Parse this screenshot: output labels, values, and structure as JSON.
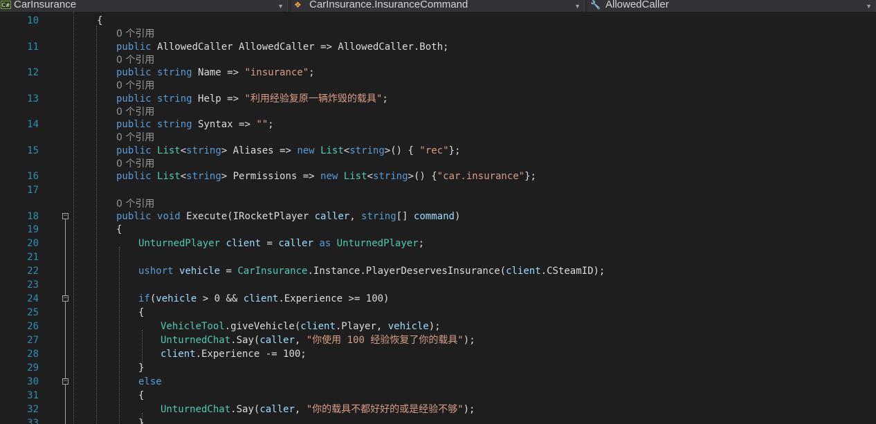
{
  "navbar": {
    "project_badge": "C#",
    "project": "CarInsurance",
    "type_member": "CarInsurance.InsuranceCommand",
    "member": "AllowedCaller"
  },
  "editor": {
    "lenses": {
      "l11": "0 个引用",
      "l12": "0 个引用",
      "l13": "0 个引用",
      "l14": "0 个引用",
      "l15": "0 个引用",
      "l16": "0 个引用",
      "l18": "0 个引用"
    },
    "lines": [
      {
        "n": "10",
        "tokens": [
          [
            "p",
            "{"
          ]
        ]
      },
      {
        "n": "11",
        "tokens": [
          [
            "k",
            "public"
          ],
          [
            "p",
            " "
          ],
          [
            "p",
            "AllowedCaller AllowedCaller => AllowedCaller.Both;"
          ]
        ]
      },
      {
        "n": "12",
        "tokens": [
          [
            "k",
            "public"
          ],
          [
            "p",
            " "
          ],
          [
            "k",
            "string"
          ],
          [
            "p",
            " Name => "
          ],
          [
            "s",
            "\"insurance\""
          ],
          [
            "p",
            ";"
          ]
        ]
      },
      {
        "n": "13",
        "tokens": [
          [
            "k",
            "public"
          ],
          [
            "p",
            " "
          ],
          [
            "k",
            "string"
          ],
          [
            "p",
            " Help => "
          ],
          [
            "s",
            "\"利用经验复原一辆炸毁的载具\""
          ],
          [
            "p",
            ";"
          ]
        ]
      },
      {
        "n": "14",
        "tokens": [
          [
            "k",
            "public"
          ],
          [
            "p",
            " "
          ],
          [
            "k",
            "string"
          ],
          [
            "p",
            " Syntax => "
          ],
          [
            "s",
            "\"\""
          ],
          [
            "p",
            ";"
          ]
        ]
      },
      {
        "n": "15",
        "tokens": [
          [
            "k",
            "public"
          ],
          [
            "p",
            " "
          ],
          [
            "t",
            "List"
          ],
          [
            "p",
            "<"
          ],
          [
            "k",
            "string"
          ],
          [
            "p",
            "> Aliases => "
          ],
          [
            "k",
            "new"
          ],
          [
            "p",
            " "
          ],
          [
            "t",
            "List"
          ],
          [
            "p",
            "<"
          ],
          [
            "k",
            "string"
          ],
          [
            "p",
            ">() { "
          ],
          [
            "s",
            "\"rec\""
          ],
          [
            "p",
            "};"
          ]
        ]
      },
      {
        "n": "16",
        "tokens": [
          [
            "k",
            "public"
          ],
          [
            "p",
            " "
          ],
          [
            "t",
            "List"
          ],
          [
            "p",
            "<"
          ],
          [
            "k",
            "string"
          ],
          [
            "p",
            "> Permissions => "
          ],
          [
            "k",
            "new"
          ],
          [
            "p",
            " "
          ],
          [
            "t",
            "List"
          ],
          [
            "p",
            "<"
          ],
          [
            "k",
            "string"
          ],
          [
            "p",
            ">() {"
          ],
          [
            "s",
            "\"car.insurance\""
          ],
          [
            "p",
            "};"
          ]
        ]
      },
      {
        "n": "17",
        "tokens": []
      },
      {
        "n": "18",
        "tokens": [
          [
            "k",
            "public"
          ],
          [
            "p",
            " "
          ],
          [
            "k",
            "void"
          ],
          [
            "p",
            " Execute(IRocketPlayer "
          ],
          [
            "v",
            "caller"
          ],
          [
            "p",
            ", "
          ],
          [
            "k",
            "string"
          ],
          [
            "p",
            "[] "
          ],
          [
            "v",
            "command"
          ],
          [
            "p",
            ")"
          ]
        ]
      },
      {
        "n": "19",
        "tokens": [
          [
            "p",
            "{"
          ]
        ]
      },
      {
        "n": "20",
        "tokens": [
          [
            "t",
            "UnturnedPlayer"
          ],
          [
            "p",
            " "
          ],
          [
            "v",
            "client"
          ],
          [
            "p",
            " = "
          ],
          [
            "v",
            "caller"
          ],
          [
            "p",
            " "
          ],
          [
            "k",
            "as"
          ],
          [
            "p",
            " "
          ],
          [
            "t",
            "UnturnedPlayer"
          ],
          [
            "p",
            ";"
          ]
        ]
      },
      {
        "n": "21",
        "tokens": []
      },
      {
        "n": "22",
        "tokens": [
          [
            "k",
            "ushort"
          ],
          [
            "p",
            " "
          ],
          [
            "v",
            "vehicle"
          ],
          [
            "p",
            " = "
          ],
          [
            "t",
            "CarInsurance"
          ],
          [
            "p",
            ".Instance.PlayerDeservesInsurance("
          ],
          [
            "v",
            "client"
          ],
          [
            "p",
            ".CSteamID);"
          ]
        ]
      },
      {
        "n": "23",
        "tokens": []
      },
      {
        "n": "24",
        "tokens": [
          [
            "k",
            "if"
          ],
          [
            "p",
            "("
          ],
          [
            "v",
            "vehicle"
          ],
          [
            "p",
            " > 0 && "
          ],
          [
            "v",
            "client"
          ],
          [
            "p",
            ".Experience >= 100)"
          ]
        ]
      },
      {
        "n": "25",
        "tokens": [
          [
            "p",
            "{"
          ]
        ]
      },
      {
        "n": "26",
        "tokens": [
          [
            "t",
            "VehicleTool"
          ],
          [
            "p",
            ".giveVehicle("
          ],
          [
            "v",
            "client"
          ],
          [
            "p",
            ".Player, "
          ],
          [
            "v",
            "vehicle"
          ],
          [
            "p",
            ");"
          ]
        ]
      },
      {
        "n": "27",
        "tokens": [
          [
            "t",
            "UnturnedChat"
          ],
          [
            "p",
            ".Say("
          ],
          [
            "v",
            "caller"
          ],
          [
            "p",
            ", "
          ],
          [
            "s",
            "\"你使用 100 经验恢复了你的载具\""
          ],
          [
            "p",
            ");"
          ]
        ]
      },
      {
        "n": "28",
        "tokens": [
          [
            "v",
            "client"
          ],
          [
            "p",
            ".Experience -= 100;"
          ]
        ]
      },
      {
        "n": "29",
        "tokens": [
          [
            "p",
            "}"
          ]
        ]
      },
      {
        "n": "30",
        "tokens": [
          [
            "k",
            "else"
          ]
        ]
      },
      {
        "n": "31",
        "tokens": [
          [
            "p",
            "{"
          ]
        ]
      },
      {
        "n": "32",
        "tokens": [
          [
            "t",
            "UnturnedChat"
          ],
          [
            "p",
            ".Say("
          ],
          [
            "v",
            "caller"
          ],
          [
            "p",
            ", "
          ],
          [
            "s",
            "\"你的载具不都好好的或是经验不够\""
          ],
          [
            "p",
            ");"
          ]
        ]
      },
      {
        "n": "33",
        "tokens": [
          [
            "p",
            "}"
          ]
        ]
      }
    ]
  }
}
